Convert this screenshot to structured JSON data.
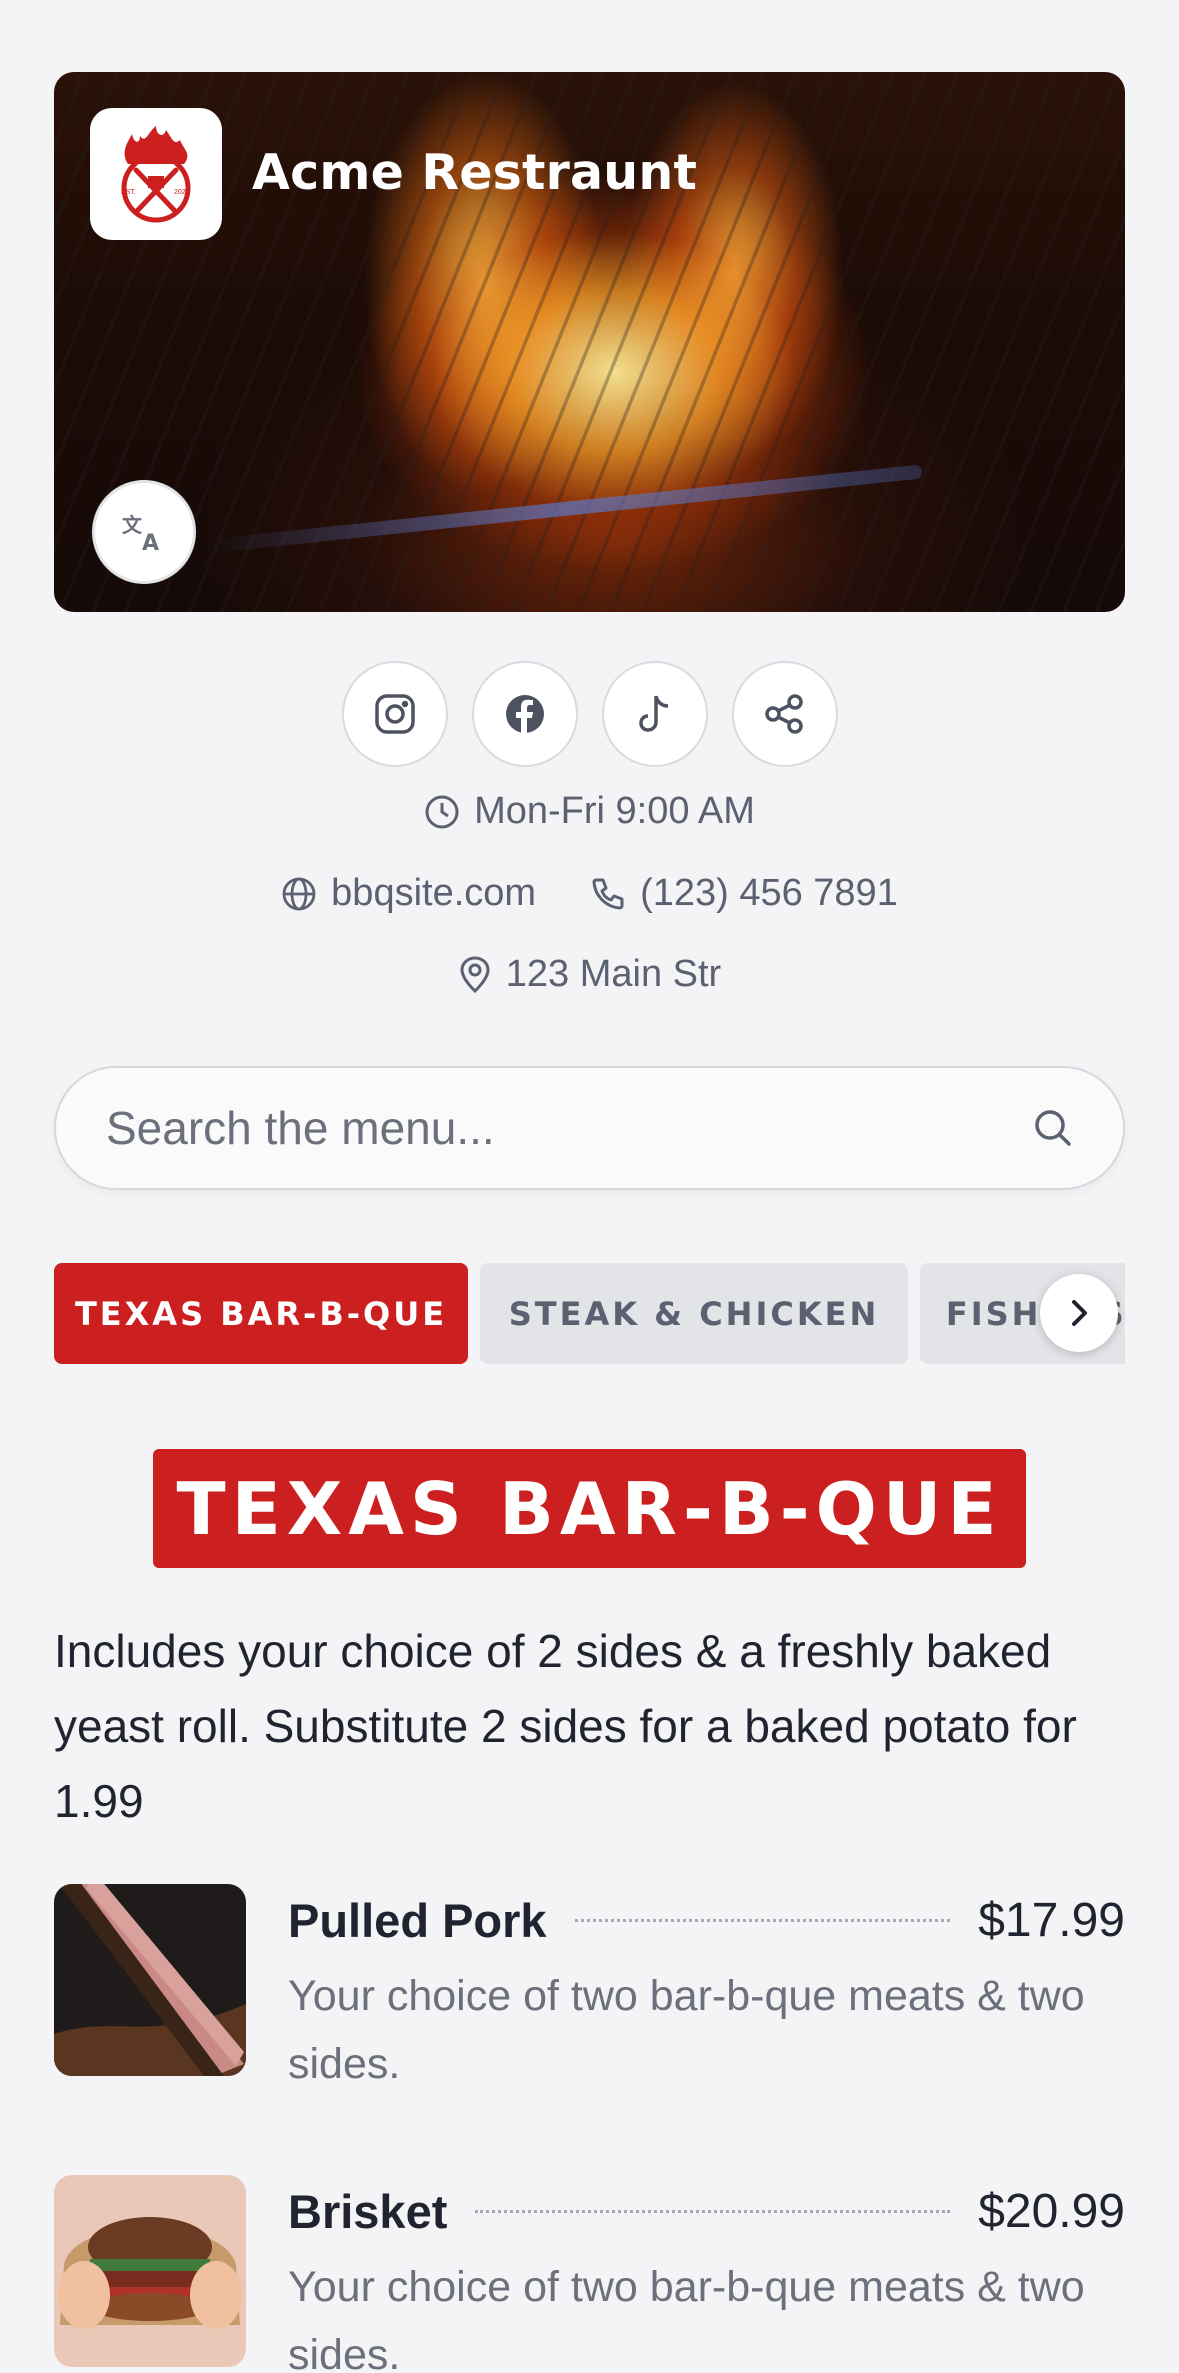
{
  "header": {
    "restaurant_name": "Acme Restraunt",
    "logo": {
      "icon": "grill-flame-logo-icon",
      "est_label": "EST.",
      "year_label": "2024"
    },
    "translate_icon": "translate-icon"
  },
  "socials": [
    {
      "name": "instagram",
      "icon": "instagram-icon"
    },
    {
      "name": "facebook",
      "icon": "facebook-icon"
    },
    {
      "name": "tiktok",
      "icon": "tiktok-icon"
    },
    {
      "name": "share",
      "icon": "share-icon"
    }
  ],
  "info": {
    "hours": "Mon-Fri 9:00 AM",
    "website": "bbqsite.com",
    "phone": "(123) 456 7891",
    "address": "123 Main Str"
  },
  "search": {
    "placeholder": "Search the menu..."
  },
  "tabs": [
    {
      "label": "TEXAS BAR-B-QUE",
      "active": true
    },
    {
      "label": "STEAK & CHICKEN",
      "active": false
    },
    {
      "label": "FISH & SEAFOOD",
      "active": false
    }
  ],
  "section": {
    "title": "TEXAS BAR-B-QUE",
    "description": "Includes your choice of 2 sides & a freshly baked yeast roll. Substitute 2 sides for a baked potato for 1.99"
  },
  "menu_items": [
    {
      "name": "Pulled Pork",
      "price": "$17.99",
      "description": "Your choice of two bar-b-que meats & two sides."
    },
    {
      "name": "Brisket",
      "price": "$20.99",
      "description": "Your choice of two bar-b-que meats & two sides."
    }
  ],
  "colors": {
    "accent": "#cc1f1f",
    "background": "#f4f4f6",
    "muted_text": "#5b6170"
  }
}
